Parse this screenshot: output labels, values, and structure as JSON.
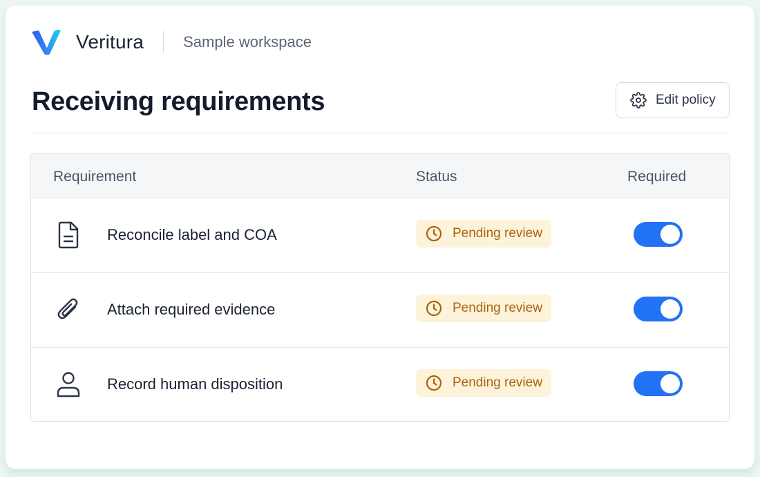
{
  "header": {
    "brand_name": "Veritura",
    "workspace": "Sample workspace"
  },
  "page": {
    "title": "Receiving requirements",
    "edit_button_label": "Edit policy",
    "edit_button_icon": "gear-icon"
  },
  "table": {
    "columns": {
      "requirement": "Requirement",
      "status": "Status",
      "required": "Required"
    },
    "rows": [
      {
        "icon": "document-icon",
        "label": "Reconcile label and COA",
        "status": "Pending review",
        "required": true
      },
      {
        "icon": "paperclip-icon",
        "label": "Attach required evidence",
        "status": "Pending review",
        "required": true
      },
      {
        "icon": "person-icon",
        "label": "Record human disposition",
        "status": "Pending review",
        "required": true
      }
    ]
  },
  "colors": {
    "accent": "#2272f5",
    "badge_background": "#fdf3da",
    "badge_text": "#a8630f",
    "logo_start": "#2563eb",
    "logo_end": "#22d3ee"
  }
}
